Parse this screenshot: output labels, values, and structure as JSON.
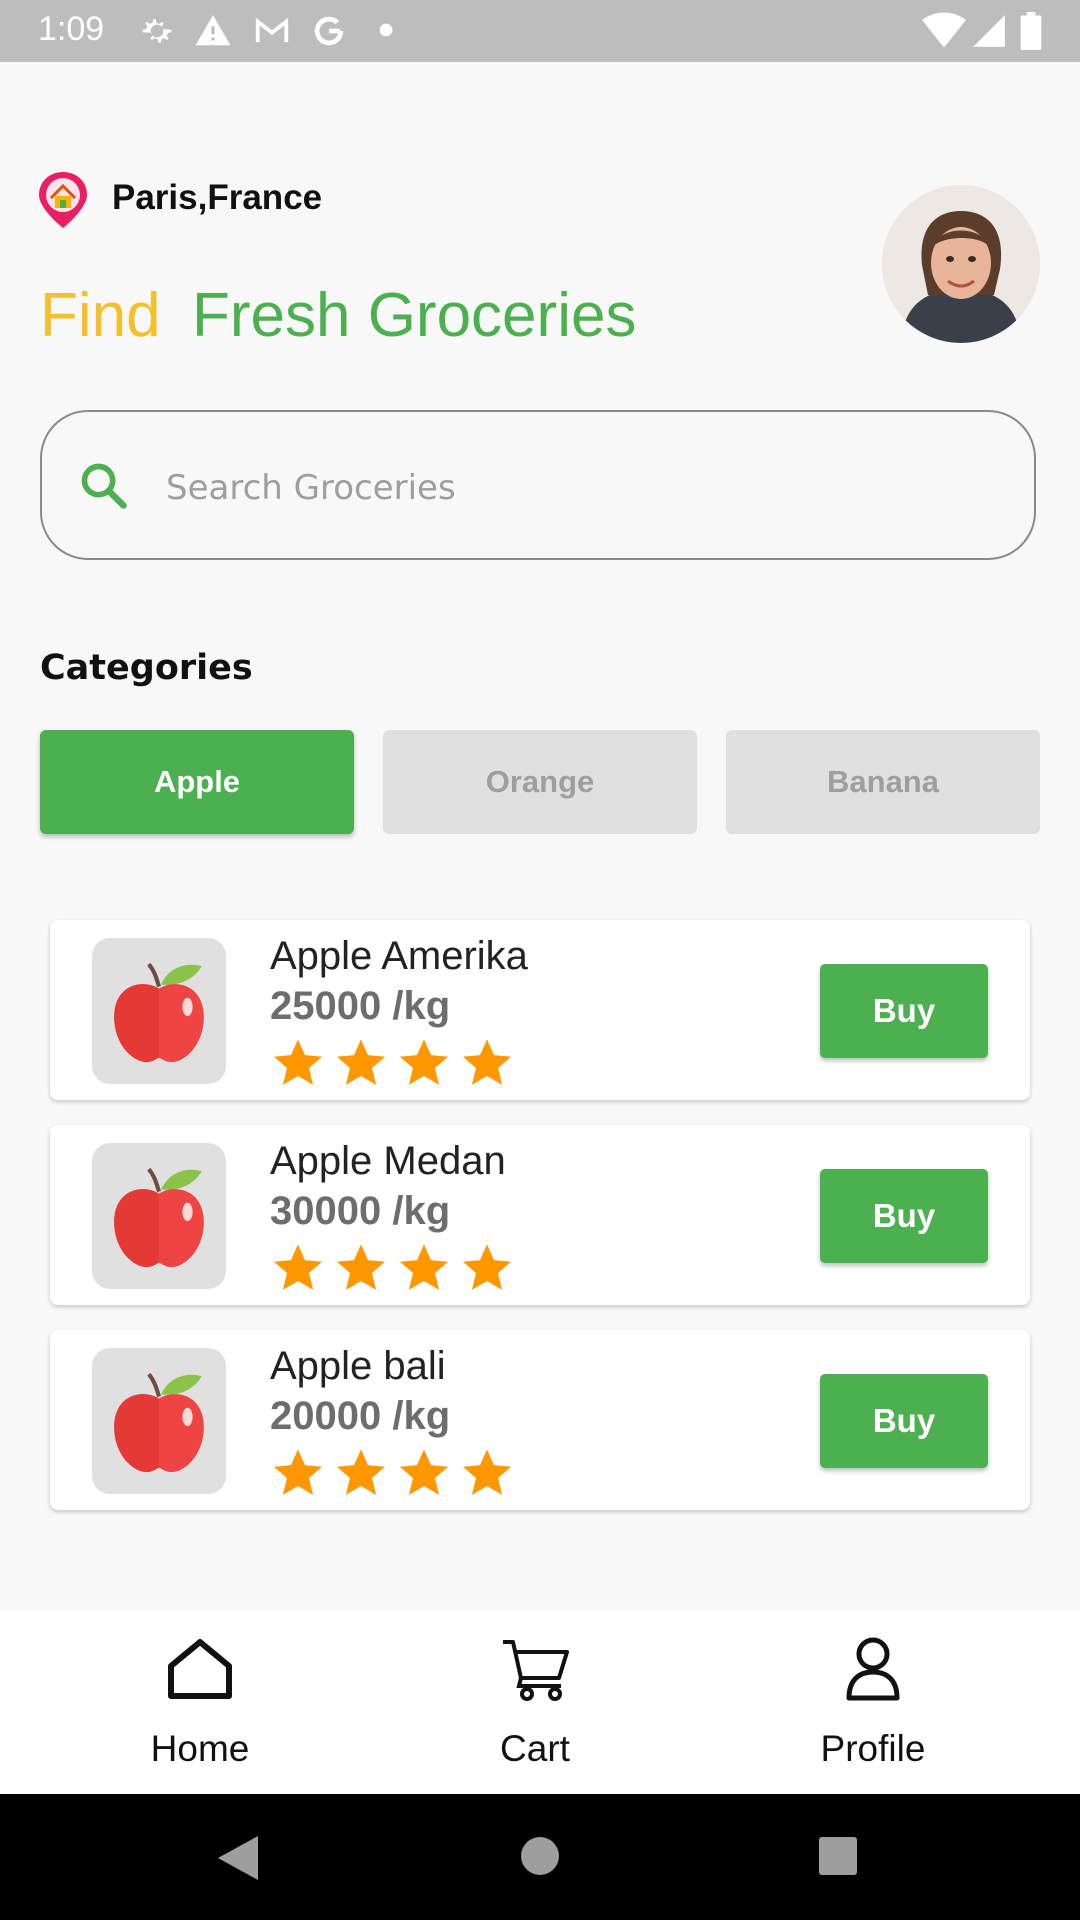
{
  "status_bar": {
    "time": "1:09",
    "left_icons": [
      "gear-icon",
      "warning-icon",
      "gmail-icon",
      "google-icon",
      "dot-icon"
    ],
    "right_icons": [
      "wifi-icon",
      "signal-icon",
      "battery-icon"
    ]
  },
  "header": {
    "location": "Paris,France",
    "title_find": "Find",
    "title_rest": "Fresh Groceries",
    "avatar_icon": "user-avatar-photo"
  },
  "search": {
    "placeholder": "Search Groceries",
    "value": "",
    "icon": "search-icon"
  },
  "categories": {
    "heading": "Categories",
    "items": [
      {
        "label": "Apple",
        "active": true
      },
      {
        "label": "Orange",
        "active": false
      },
      {
        "label": "Banana",
        "active": false
      }
    ]
  },
  "products": [
    {
      "name": "Apple Amerika",
      "price": "25000 /kg",
      "rating": 4,
      "buy_label": "Buy",
      "image_icon": "apple-icon"
    },
    {
      "name": "Apple Medan",
      "price": "30000 /kg",
      "rating": 4,
      "buy_label": "Buy",
      "image_icon": "apple-icon"
    },
    {
      "name": "Apple bali",
      "price": "20000 /kg",
      "rating": 4,
      "buy_label": "Buy",
      "image_icon": "apple-icon"
    }
  ],
  "bottom_nav": {
    "items": [
      {
        "label": "Home",
        "icon": "home-icon"
      },
      {
        "label": "Cart",
        "icon": "cart-icon"
      },
      {
        "label": "Profile",
        "icon": "profile-icon"
      }
    ]
  },
  "colors": {
    "accent_green": "#4caf50",
    "accent_yellow": "#f5c02a",
    "star_orange": "#ff9800",
    "status_bar_gray": "#bdbdbd"
  }
}
